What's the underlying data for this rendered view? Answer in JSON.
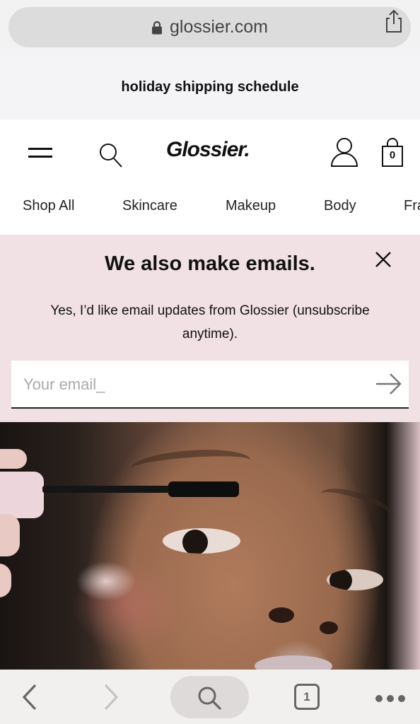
{
  "browser": {
    "url": "glossier.com",
    "lock_icon": "lock-icon",
    "share_icon": "share-icon"
  },
  "promo_banner": {
    "text": "holiday shipping schedule"
  },
  "header": {
    "logo": "Glossier.",
    "menu_icon": "hamburger-icon",
    "search_icon": "search-icon",
    "account_icon": "account-icon",
    "bag_icon": "shopping-bag-icon",
    "bag_count": "0"
  },
  "nav": {
    "items": [
      {
        "label": "Shop All"
      },
      {
        "label": "Skincare"
      },
      {
        "label": "Makeup"
      },
      {
        "label": "Body"
      },
      {
        "label": "Fragrance"
      }
    ]
  },
  "email_signup": {
    "title": "We also make emails.",
    "description": "Yes, I’d like email updates from Glossier (unsubscribe anytime).",
    "input_placeholder": "Your email_",
    "input_value": "",
    "submit_icon": "arrow-right-icon",
    "close_icon": "close-icon",
    "background": "#f2e1e4"
  },
  "hero": {
    "image_alt": "Close-up of a woman applying mascara"
  },
  "browser_toolbar": {
    "back_icon": "chevron-left-icon",
    "forward_icon": "chevron-right-icon",
    "search_icon": "search-icon",
    "tab_count": "1",
    "more_icon": "more-icon"
  }
}
